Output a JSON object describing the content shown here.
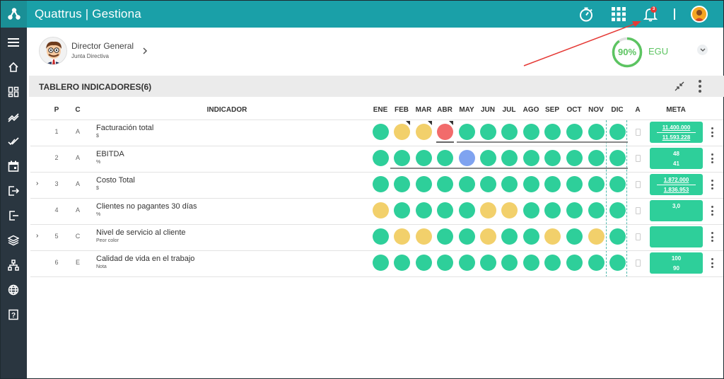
{
  "app": {
    "title": "Quattrus | Gestiona",
    "notification_count": "3"
  },
  "topbar_icons": [
    "stopwatch-icon",
    "apps-grid-icon",
    "bell-icon",
    "user-avatar"
  ],
  "sidebar": {
    "items": [
      "menu-icon",
      "home-icon",
      "dashboard-icon",
      "trend-icon",
      "double-check-icon",
      "calendar-icon",
      "logout-icon",
      "exit-icon",
      "layers-icon",
      "org-chart-icon",
      "globe-icon",
      "help-icon"
    ]
  },
  "profile": {
    "name": "Director General",
    "subtitle": "Junta Directiva"
  },
  "egu": {
    "percent": "90%",
    "value": 0.9,
    "label": "EGU"
  },
  "panel": {
    "title": "TABLERO INDICADORES(6)"
  },
  "columns": {
    "p": "P",
    "c": "C",
    "indicator": "INDICADOR",
    "months": [
      "ENE",
      "FEB",
      "MAR",
      "ABR",
      "MAY",
      "JUN",
      "JUL",
      "AGO",
      "SEP",
      "OCT",
      "NOV",
      "DIC"
    ],
    "a": "A",
    "meta": "META"
  },
  "colors": {
    "green": "#2ecf9a",
    "yellow": "#f2d06b",
    "red": "#f26b6b",
    "blue": "#7fa3f0",
    "teal": "#1aa0a8"
  },
  "rows": [
    {
      "p": "1",
      "c": "A",
      "name": "Facturación total",
      "unit": "$",
      "expandable": false,
      "status": [
        "green",
        "yellow",
        "yellow",
        "red",
        "green",
        "green",
        "green",
        "green",
        "green",
        "green",
        "green",
        "green"
      ],
      "meta": [
        "11.400.000",
        "11.593.228"
      ],
      "meta_underlined": true
    },
    {
      "p": "2",
      "c": "A",
      "name": "EBITDA",
      "unit": "%",
      "expandable": false,
      "status": [
        "green",
        "green",
        "green",
        "green",
        "blue",
        "green",
        "green",
        "green",
        "green",
        "green",
        "green",
        "green"
      ],
      "meta": [
        "48",
        "41"
      ],
      "meta_underlined": false
    },
    {
      "p": "3",
      "c": "A",
      "name": "Costo Total",
      "unit": "$",
      "expandable": true,
      "status": [
        "green",
        "green",
        "green",
        "green",
        "green",
        "green",
        "green",
        "green",
        "green",
        "green",
        "green",
        "green"
      ],
      "meta": [
        "1.872.000",
        "1.836.953"
      ],
      "meta_underlined": true
    },
    {
      "p": "4",
      "c": "A",
      "name": "Clientes no pagantes 30 días",
      "unit": "%",
      "expandable": false,
      "status": [
        "yellow",
        "green",
        "green",
        "green",
        "green",
        "yellow",
        "yellow",
        "green",
        "green",
        "green",
        "green",
        "green"
      ],
      "meta": [
        "3,0",
        ""
      ],
      "meta_underlined": false
    },
    {
      "p": "5",
      "c": "C",
      "name": "Nivel de servicio al cliente",
      "unit": "Peor color",
      "expandable": true,
      "status": [
        "green",
        "yellow",
        "yellow",
        "green",
        "green",
        "yellow",
        "green",
        "green",
        "yellow",
        "green",
        "yellow",
        "green"
      ],
      "meta": [
        "",
        ""
      ],
      "meta_underlined": false
    },
    {
      "p": "6",
      "c": "E",
      "name": "Calidad de vida en el trabajo",
      "unit": "Nota",
      "expandable": false,
      "status": [
        "green",
        "green",
        "green",
        "green",
        "green",
        "green",
        "green",
        "green",
        "green",
        "green",
        "green",
        "green"
      ],
      "meta": [
        "100",
        "90"
      ],
      "meta_underlined": false
    }
  ]
}
